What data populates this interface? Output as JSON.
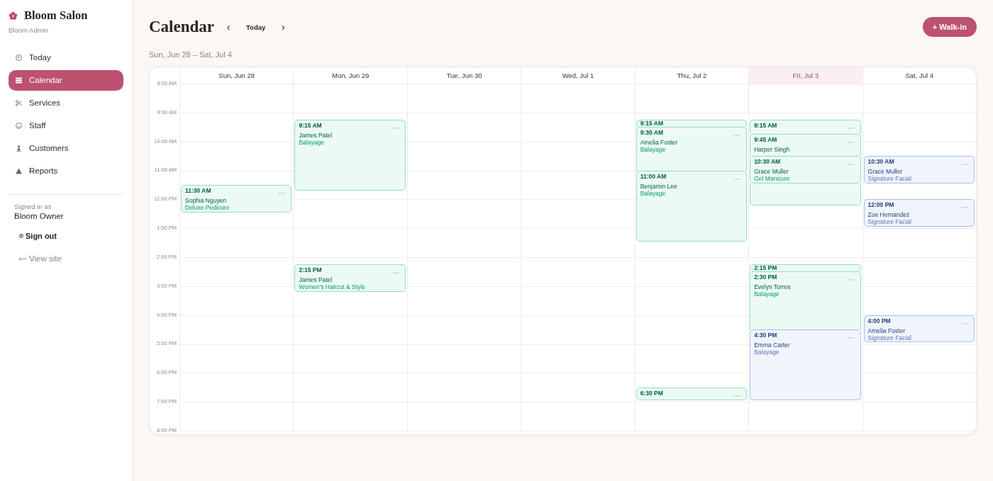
{
  "sidebar": {
    "brand": "Bloom Salon",
    "subtitle": "Bloom Admin",
    "nav": [
      {
        "label": "Today",
        "selected": false
      },
      {
        "label": "Calendar",
        "selected": true
      },
      {
        "label": "Services",
        "selected": false
      },
      {
        "label": "Staff",
        "selected": false
      },
      {
        "label": "Customers",
        "selected": false
      },
      {
        "label": "Reports",
        "selected": false
      }
    ],
    "account": {
      "caption": "Signed in as",
      "name": "Bloom Owner",
      "sign_out": "Sign out",
      "view_site": "View site"
    }
  },
  "header": {
    "title": "Calendar",
    "prev": "‹",
    "today": "Today",
    "next": "›",
    "action": "+ Walk-in",
    "range": "Sun, Jun 28 – Sat, Jul 4"
  },
  "calendar": {
    "hours": [
      "8:00 AM",
      "9:00 AM",
      "10:00 AM",
      "11:00 AM",
      "12:00 PM",
      "1:00 PM",
      "2:00 PM",
      "3:00 PM",
      "4:00 PM",
      "5:00 PM",
      "6:00 PM",
      "7:00 PM",
      "8:00 PM"
    ],
    "days": [
      {
        "label": "Sun, Jun 28",
        "today": false,
        "events": [
          {
            "kind": "standard",
            "time": "11:30 AM",
            "client": "Sophia Nguyen",
            "service": "Deluxe Pedicure",
            "color": "#8fe0c0"
          }
        ]
      },
      {
        "label": "Mon, Jun 29",
        "today": false,
        "events": [
          {
            "kind": "long",
            "time": "9:15 AM",
            "client": "James Patel",
            "service": "Balayage",
            "color": "#8fe0c0"
          },
          {
            "kind": "standard",
            "time": "2:15 PM",
            "client": "James Patel",
            "service": "Women's Haircut & Style",
            "color": "#8fe0c0"
          }
        ]
      },
      {
        "label": "Tue, Jun 30",
        "today": false
      },
      {
        "label": "Wed, Jul 1",
        "today": false
      },
      {
        "label": "Thu, Jul 2",
        "today": false,
        "events": [
          {
            "kind": "standard",
            "time": "9:15 AM",
            "color": "#8fe0c0"
          },
          {
            "kind": "long",
            "time": "9:30 AM",
            "client": "Amelia Foster",
            "service": "Balayage",
            "color": "#8fe0c0"
          },
          {
            "kind": "long",
            "time": "11:00 AM",
            "client": "Benjamin Lee",
            "service": "Balayage",
            "color": "#8fe0c0"
          },
          {
            "kind": "short",
            "time": "6:30 PM",
            "color": "#8fe0c0"
          }
        ]
      },
      {
        "label": "Fri, Jul 3",
        "today": true,
        "events": [
          {
            "kind": "standard",
            "time": "9:15 AM",
            "color": "#8fe0c0"
          },
          {
            "kind": "long",
            "time": "9:45 AM",
            "client": "Harper Singh",
            "color": "#8fe0c0"
          },
          {
            "kind": "standard",
            "time": "10:30 AM",
            "client": "Grace Muller",
            "service": "Gel Manicure",
            "color": "#8fe0c0"
          },
          {
            "kind": "standard",
            "time": "2:15 PM",
            "color": "#8fe0c0"
          },
          {
            "kind": "long",
            "time": "2:30 PM",
            "client": "Evelyn Torres",
            "service": "Balayage",
            "color": "#8fe0c0"
          },
          {
            "kind": "long",
            "time": "4:30 PM",
            "client": "Emma Carter",
            "service": "Balayage",
            "color": "#a7bfec"
          }
        ]
      },
      {
        "label": "Sat, Jul 4",
        "today": false,
        "events": [
          {
            "kind": "standard",
            "time": "10:30 AM",
            "client": "Grace Muller",
            "service": "Signature Facial",
            "color": "#a7bfec"
          },
          {
            "kind": "standard",
            "time": "12:00 PM",
            "client": "Zoe Hernandez",
            "service": "Signature Facial",
            "color": "#a7bfec"
          },
          {
            "kind": "standard",
            "time": "4:00 PM",
            "client": "Amelia Foster",
            "service": "Signature Facial",
            "color": "#a7bfec"
          }
        ]
      }
    ]
  }
}
